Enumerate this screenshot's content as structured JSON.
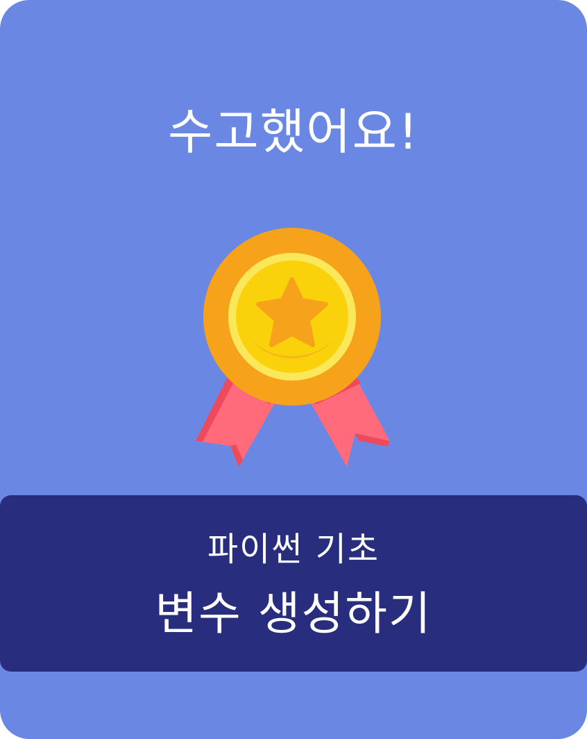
{
  "card": {
    "headline": "수고했어요!",
    "badge_icon": "award-medal-icon",
    "course_name": "파이썬 기초",
    "lesson_title": "변수 생성하기"
  },
  "colors": {
    "card_background": "#6a87e3",
    "panel_background": "#282d7e",
    "medal_outer": "#f7a21b",
    "medal_inner": "#f9d20b",
    "medal_ring": "#fbe85a",
    "star": "#f7a21b",
    "ribbon": "#ff6b7a",
    "ribbon_shadow": "#ef4a5b",
    "text": "#ffffff"
  }
}
